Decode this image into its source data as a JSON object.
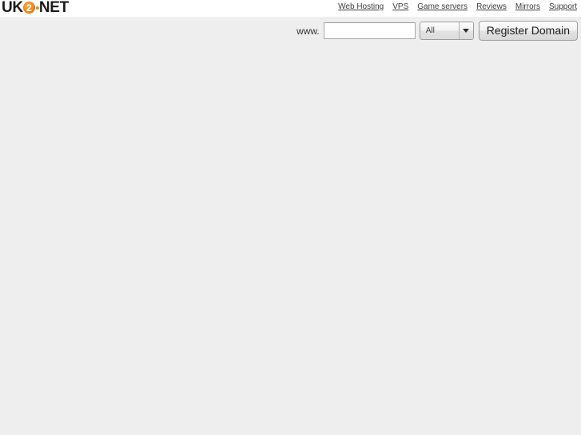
{
  "site": {
    "logo": {
      "prefix": "UK",
      "mark_text": "2",
      "suffix": "NET",
      "accent_color": "#f08a1e"
    }
  },
  "nav": {
    "items": [
      {
        "label": "Web Hosting"
      },
      {
        "label": "VPS"
      },
      {
        "label": "Game servers"
      },
      {
        "label": "Reviews"
      },
      {
        "label": "Mirrors"
      },
      {
        "label": "Support"
      }
    ]
  },
  "domain_search": {
    "prefix_label": "www.",
    "input_value": "",
    "input_placeholder": "",
    "tld_selected": "All",
    "submit_label": "Register Domain"
  },
  "colors": {
    "header_background": "#ffffff",
    "body_background": "#eeeeee",
    "link_color": "#3c3c3c",
    "brand_orange": "#f08a1e"
  }
}
